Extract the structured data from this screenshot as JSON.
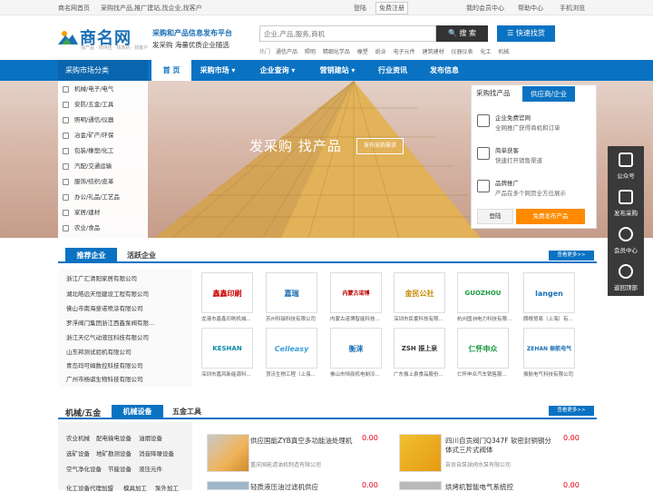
{
  "topbar": {
    "home": "商名网首页",
    "tagline": "采购找产品,推广建站,找企业,找客户",
    "login": "登陆",
    "register": "免费注册",
    "member": "我的会员中心",
    "help": "帮助中心",
    "mobile": "手机浏览"
  },
  "header": {
    "logo_text": "商名网",
    "logo_sub": "找产品 · 找供应 · 找商机 · 找客户",
    "slogan_line1": "采购和产品信息发布平台",
    "slogan_line2": "发采购 海量优质企业随选",
    "search_placeholder": "企业,产品,服务,商机",
    "search_btn": "搜 索",
    "quick_btn": "快速找货",
    "hot_label": "热门",
    "hot_words": [
      "通信产品",
      "照明",
      "精细化学品",
      "橡塑",
      "纸业",
      "电子元件",
      "建筑建材",
      "仪器仪表",
      "化工",
      "机械"
    ]
  },
  "nav": {
    "category_title": "采购市场分类",
    "items": [
      "首 页",
      "采购市场",
      "企业查询",
      "营销建站",
      "行业资讯",
      "发布信息"
    ]
  },
  "sidebar": {
    "items": [
      "机械/电子/电气",
      "安防/五金/工具",
      "照明/通信/仪器",
      "冶金/矿产/环保",
      "包装/橡塑/化工",
      "汽配/交通运输",
      "服饰/纺织/皮革",
      "办公/礼品/工艺品",
      "家居/建材",
      "农业/食品"
    ]
  },
  "banner": {
    "title": "发采购 找产品",
    "button": "发布采购需求"
  },
  "right_panel": {
    "tab1": "采购找产品",
    "tab2": "供应商/企业",
    "rows": [
      {
        "t1": "企业免费官网",
        "t2": "全网推广获得商机和订单"
      },
      {
        "t1": "简单获客",
        "t2": "快速打开销售渠道"
      },
      {
        "t1": "品牌推广",
        "t2": "产品在多个网页全方位展示"
      }
    ],
    "login": "登陆",
    "publish": "免费发布产品"
  },
  "side_float": [
    "公众号",
    "发布采购",
    "会员中心",
    "返回顶部"
  ],
  "companies": {
    "tab_recommended": "推荐企业",
    "tab_active": "活跃企业",
    "more": "查看更多>>",
    "list": [
      "浙江广汇清阳家居有限公司",
      "湖北皓远天恒建设工程有限公司",
      "佛山市南海斐诺喷涂有限公司",
      "罗浮阀门集团浙江西鑫泵阀有限...",
      "浙江天亿气动液压科技有限公司",
      "山东邦测试验机有限公司",
      "青岛玛可姆数控科技有限公司",
      "广州市杨骐生物科技有限公司"
    ],
    "logos": [
      {
        "text": "鑫鑫印刷",
        "caption": "龙港市鑫鑫印刷机械..."
      },
      {
        "text": "嘉瑞",
        "caption": "苏州科瑞科技有限公司"
      },
      {
        "text": "内蒙古诺博",
        "caption": "内蒙古诺博智能科技..."
      },
      {
        "text": "金民公社",
        "caption": "深圳市民委科技有限..."
      },
      {
        "text": "GUOZHOU",
        "caption": "杭州国洲电力科技有限..."
      },
      {
        "text": "langen",
        "caption": "朗根贸易（上海）有..."
      },
      {
        "text": "KESHAN",
        "caption": "深圳市嘉风新能源科..."
      },
      {
        "text": "Celleasy",
        "caption": "顶沃生物工程（上海..."
      },
      {
        "text": "衡涞",
        "caption": "佛山市恒辰机电制冷..."
      },
      {
        "text": "ZSH 振上泉",
        "caption": "广东振上泉食品股份..."
      },
      {
        "text": "仁怀申众",
        "caption": "仁怀申众汽车销售服..."
      },
      {
        "text": "ZEHAN 振航电气",
        "caption": "振航电气科技有限公司"
      }
    ]
  },
  "machinery": {
    "title": "机械/五金",
    "tab1": "机械设备",
    "tab2": "五金工具",
    "more": "查看更多>>",
    "keywords": [
      "农业机械",
      "配电输电设备",
      "油烟设备",
      "选矿设备",
      "地矿勘测设备",
      "消音降噪设备",
      "空气净化设备",
      "节能设备",
      "液压元件",
      "化工设备代理加盟",
      "模具加工",
      "泵外加工"
    ],
    "products": [
      {
        "title": "供应国能ZYB真空多功能油处理机",
        "company": "重庆国能滤油机制造有限公司",
        "price": "0.00"
      },
      {
        "title": "四川自贡阀门Q347F 软密封铜钢分体式三片式阀体",
        "company": "自贡自泵球阀水泵有限公司",
        "price": "0.00"
      },
      {
        "title": "轻质液压油过滤机供应",
        "company": "",
        "price": "0.00"
      },
      {
        "title": "烘烤机智能电气系统控",
        "company": "",
        "price": "0.00"
      }
    ]
  }
}
